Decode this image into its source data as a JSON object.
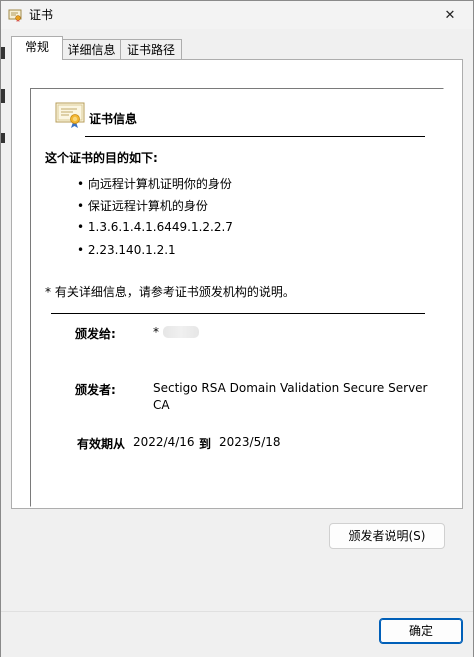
{
  "window": {
    "title": "证书",
    "close_glyph": "✕"
  },
  "tabs": [
    {
      "label": "常规"
    },
    {
      "label": "详细信息"
    },
    {
      "label": "证书路径"
    }
  ],
  "general": {
    "heading": "证书信息",
    "purpose_title": "这个证书的目的如下:",
    "purposes": [
      "• 向远程计算机证明你的身份",
      "• 保证远程计算机的身份",
      "• 1.3.6.1.4.1.6449.1.2.2.7",
      "• 2.23.140.1.2.1"
    ],
    "note": "* 有关详细信息，请参考证书颁发机构的说明。",
    "issued_to_label": "颁发给:",
    "issued_to_value": "*",
    "issued_by_label": "颁发者:",
    "issued_by_value_line1": "Sectigo RSA Domain Validation Secure Server",
    "issued_by_value_line2": "CA",
    "valid_from_label": "有效期从",
    "valid_from_value": "2022/4/16",
    "valid_to_label": "到",
    "valid_to_value": "2023/5/18"
  },
  "buttons": {
    "issuer_statement": "颁发者说明(S)",
    "ok": "确定"
  },
  "colors": {
    "accent": "#005fb8",
    "window_bg": "#f0f0f0",
    "panel_bg": "#ffffff"
  },
  "icons": {
    "title": "certificate-icon",
    "heading": "certificate-icon",
    "close": "close-icon"
  }
}
